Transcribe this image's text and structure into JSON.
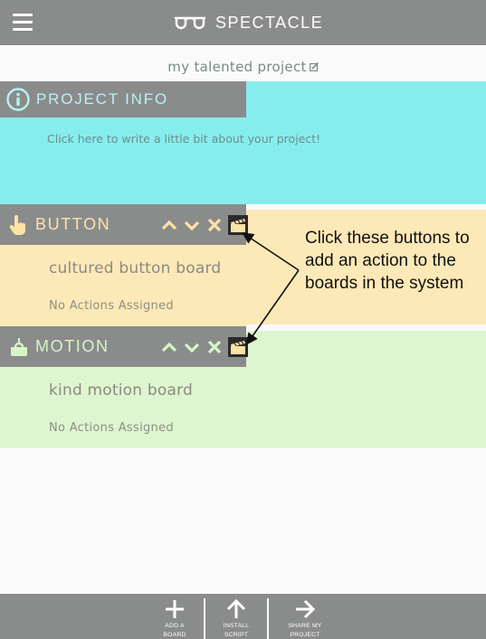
{
  "app": {
    "brand_name": "SPECTACLE",
    "menu_icon": "hamburger-menu-icon",
    "logo_icon": "spectacles-logo-icon"
  },
  "project": {
    "title": "my talented project",
    "edit_icon": "edit-icon"
  },
  "project_info": {
    "heading": "PROJECT INFO",
    "icon": "info-icon",
    "description": "Click here to write a little bit about your project!"
  },
  "boards": [
    {
      "type_label": "BUTTON",
      "type_icon": "pointing-hand-icon",
      "name": "cultured button board",
      "actions_text": "No Actions Assigned",
      "color": "#fde9b7"
    },
    {
      "type_label": "MOTION",
      "type_icon": "motion-sensor-icon",
      "name": "kind motion board",
      "actions_text": "No Actions Assigned",
      "color": "#def6cf"
    }
  ],
  "callout": {
    "text": "Click these buttons to add an action to the boards in the system"
  },
  "toolbar": {
    "add_board_label": "ADD A\nBOARD",
    "install_script_label": "INSTALL\nSCRIPT",
    "share_project_label": "SHARE MY\nPROJECT"
  },
  "colors": {
    "bar": "#8a8c8b",
    "info_bg": "#86eded",
    "button_board_bg": "#fde9b7",
    "motion_board_bg": "#def6cf"
  }
}
